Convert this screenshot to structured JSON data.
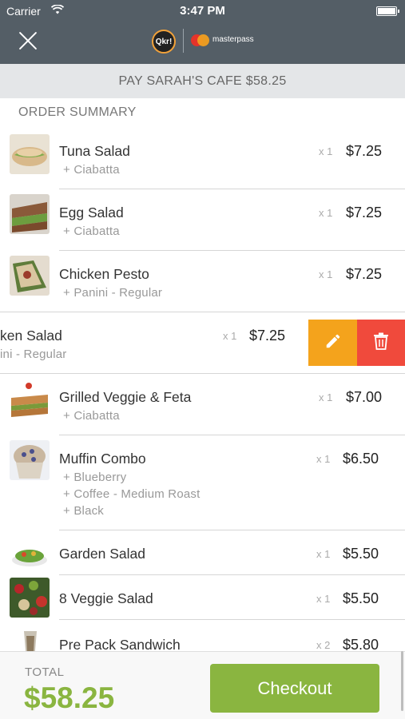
{
  "status_bar": {
    "carrier": "Carrier",
    "time": "3:47 PM"
  },
  "header": {
    "close_icon": "close-icon",
    "qkr_logo_text": "Qkr!",
    "masterpass_text": "masterpass"
  },
  "pay_banner": "PAY SARAH'S CAFE $58.25",
  "order_summary_title": "ORDER SUMMARY",
  "items": [
    {
      "name": "Tuna Salad",
      "options": [
        "+ Ciabatta"
      ],
      "qty": "x 1",
      "price": "$7.25"
    },
    {
      "name": "Egg Salad",
      "options": [
        "+ Ciabatta"
      ],
      "qty": "x 1",
      "price": "$7.25"
    },
    {
      "name": "Chicken Pesto",
      "options": [
        "+ Panini - Regular"
      ],
      "qty": "x 1",
      "price": "$7.25"
    },
    {
      "name": "ken Salad",
      "options": [
        "ini - Regular"
      ],
      "qty": "x 1",
      "price": "$7.25"
    },
    {
      "name": "Grilled Veggie & Feta",
      "options": [
        "+ Ciabatta"
      ],
      "qty": "x 1",
      "price": "$7.00"
    },
    {
      "name": "Muffin Combo",
      "options": [
        "+ Blueberry",
        "+ Coffee - Medium Roast",
        "+ Black"
      ],
      "qty": "x 1",
      "price": "$6.50"
    },
    {
      "name": "Garden Salad",
      "options": [],
      "qty": "x 1",
      "price": "$5.50"
    },
    {
      "name": "8 Veggie Salad",
      "options": [],
      "qty": "x 1",
      "price": "$5.50"
    },
    {
      "name": "Pre Pack Sandwich",
      "options": [],
      "qty": "x 2",
      "price": "$5.80"
    }
  ],
  "swipe_actions": {
    "edit_icon": "pencil-icon",
    "delete_icon": "trash-icon",
    "edit_color": "#f4a31c",
    "delete_color": "#f04a3c"
  },
  "footer": {
    "total_label": "TOTAL",
    "total_value": "$58.25",
    "checkout_label": "Checkout"
  },
  "colors": {
    "header_bg": "#545e66",
    "accent_green": "#8ab540"
  }
}
